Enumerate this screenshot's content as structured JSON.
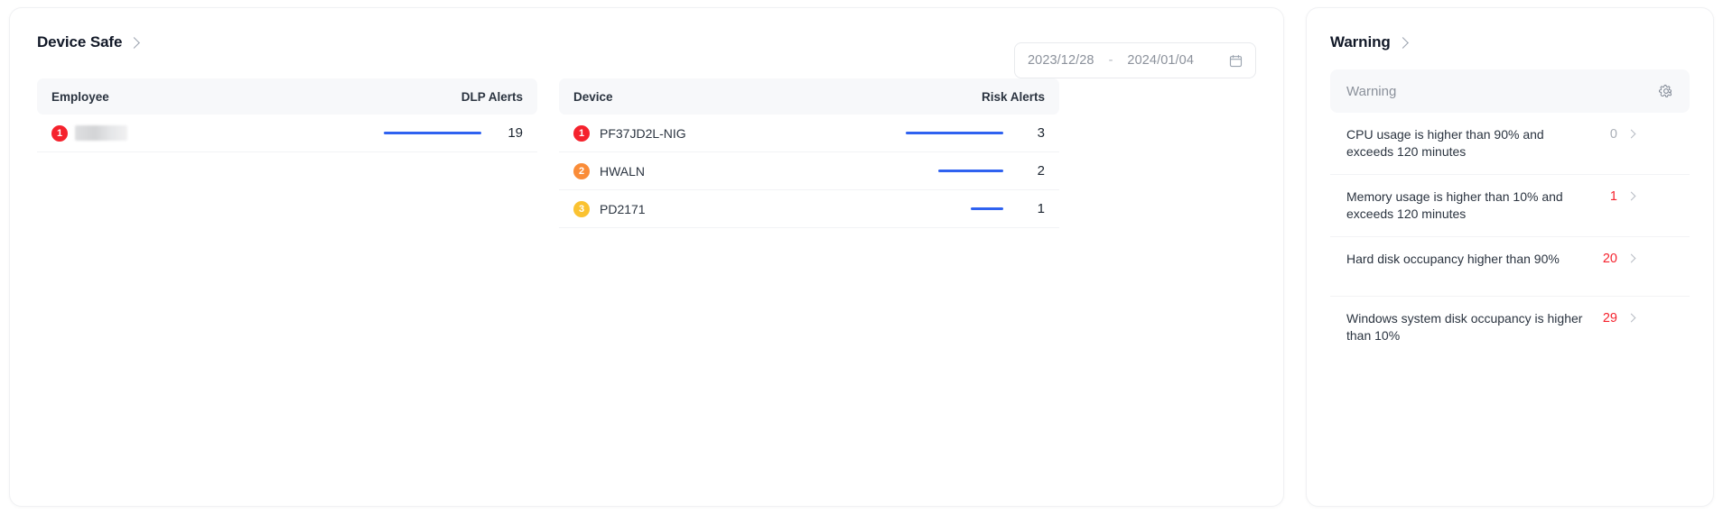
{
  "left_panel": {
    "title": "Device Safe",
    "chevron_icon": "chevron-right-icon",
    "date_range": {
      "start": "2023/12/28",
      "separator": "-",
      "end": "2024/01/04",
      "calendar_icon": "calendar-icon"
    },
    "employee_table": {
      "col_name": "Employee",
      "col_value": "DLP Alerts",
      "rows": [
        {
          "rank": "1",
          "rank_color": "#f5222d",
          "label": "",
          "redacted": true,
          "value": "19",
          "bar_pct": 100
        }
      ]
    },
    "device_table": {
      "col_name": "Device",
      "col_value": "Risk Alerts",
      "rows": [
        {
          "rank": "1",
          "rank_color": "#f5222d",
          "label": "PF37JD2L-NIG",
          "value": "3",
          "bar_pct": 100
        },
        {
          "rank": "2",
          "rank_color": "#fa8c38",
          "label": "HWALN",
          "value": "2",
          "bar_pct": 67
        },
        {
          "rank": "3",
          "rank_color": "#fac231",
          "label": "PD2171",
          "value": "1",
          "bar_pct": 33
        }
      ]
    }
  },
  "right_panel": {
    "title": "Warning",
    "chevron_icon": "chevron-right-icon",
    "section_label": "Warning",
    "gear_icon": "gear-icon",
    "items": [
      {
        "text": "CPU usage is higher than 90% and exceeds 120 minutes",
        "count": "0",
        "state": "zero"
      },
      {
        "text": "Memory usage is higher than 10% and exceeds 120 minutes",
        "count": "1",
        "state": "alert"
      },
      {
        "text": "Hard disk occupancy higher than 90%",
        "count": "20",
        "state": "alert"
      },
      {
        "text": "Windows system disk occupancy is higher than 10%",
        "count": "29",
        "state": "alert"
      }
    ]
  },
  "colors": {
    "bar": "#2f62f0",
    "alert": "#f5222d",
    "muted": "#a9aeb6",
    "header_bg": "#f7f8fa"
  }
}
